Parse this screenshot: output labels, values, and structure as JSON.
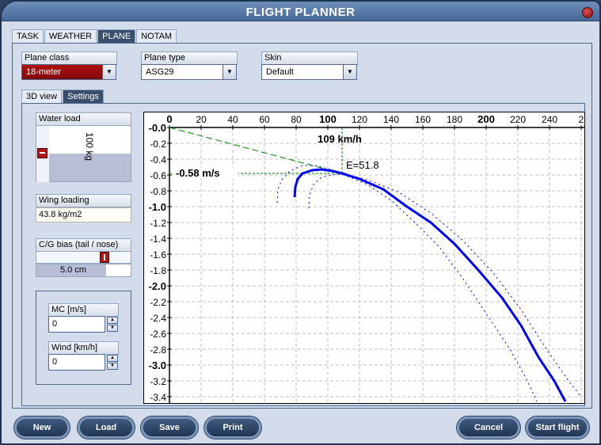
{
  "window": {
    "title": "FLIGHT PLANNER"
  },
  "tabs": [
    {
      "label": "TASK"
    },
    {
      "label": "WEATHER"
    },
    {
      "label": "PLANE",
      "active": true
    },
    {
      "label": "NOTAM"
    }
  ],
  "plane_class": {
    "label": "Plane class",
    "value": "18-meter"
  },
  "plane_type": {
    "label": "Plane type",
    "value": "ASG29"
  },
  "skin": {
    "label": "Skin",
    "value": "Default"
  },
  "subtabs": [
    {
      "label": "3D view"
    },
    {
      "label": "Settings",
      "active": true
    }
  ],
  "water_load": {
    "label": "Water load",
    "value": "100 kg"
  },
  "wing_loading": {
    "label": "Wing loading",
    "value": "43.8 kg/m2"
  },
  "cg_bias": {
    "label": "C/G bias (tail / nose)",
    "value": "5.0 cm"
  },
  "mc": {
    "label": "MC [m/s]",
    "value": "0"
  },
  "wind": {
    "label": "Wind [km/h]",
    "value": "0"
  },
  "buttons": {
    "new": "New",
    "load": "Load",
    "save": "Save",
    "print": "Print",
    "cancel": "Cancel",
    "start": "Start flight"
  },
  "colors": {
    "accent": "#3a4f6c",
    "polar": "#0000ff",
    "tangent": "#008000",
    "red": "#a00c0c"
  },
  "chart_data": {
    "type": "line",
    "xlim": [
      0,
      260
    ],
    "ylim": [
      -3.45,
      0
    ],
    "x_ticks": [
      0,
      20,
      40,
      60,
      80,
      100,
      120,
      140,
      160,
      180,
      200,
      220,
      240,
      260
    ],
    "x_tick_labels": [
      "0",
      "20",
      "40",
      "60",
      "80",
      "100",
      "120",
      "140",
      "160",
      "180",
      "200",
      "220",
      "240",
      "2"
    ],
    "y_ticks": [
      0,
      -0.2,
      -0.4,
      -0.6,
      -0.8,
      -1.0,
      -1.2,
      -1.4,
      -1.6,
      -1.8,
      -2.0,
      -2.2,
      -2.4,
      -2.6,
      -2.8,
      -3.0,
      -3.2,
      -3.4
    ],
    "y_tick_labels": [
      "-0.0",
      "-0.2",
      "-0.4",
      "-0.6",
      "-0.8",
      "-1.0",
      "-1.2",
      "-1.4",
      "-1.6",
      "-1.8",
      "-2.0",
      "-2.2",
      "-2.4",
      "-2.6",
      "-2.8",
      "-3.0",
      "-3.2",
      "-3.4"
    ],
    "grid": true,
    "series": [
      {
        "style": "solid",
        "points": [
          [
            79,
            -0.88
          ],
          [
            79.5,
            -0.75
          ],
          [
            81,
            -0.65
          ],
          [
            84,
            -0.58
          ],
          [
            90,
            -0.54
          ],
          [
            96,
            -0.53
          ],
          [
            103,
            -0.55
          ],
          [
            109,
            -0.58
          ],
          [
            120,
            -0.65
          ],
          [
            135,
            -0.78
          ],
          [
            150,
            -1.0
          ],
          [
            165,
            -1.2
          ],
          [
            180,
            -1.47
          ],
          [
            195,
            -1.8
          ],
          [
            210,
            -2.15
          ],
          [
            222,
            -2.5
          ],
          [
            233,
            -2.9
          ],
          [
            243,
            -3.2
          ],
          [
            250,
            -3.46
          ]
        ]
      },
      {
        "style": "dotted",
        "points": [
          [
            68,
            -0.95
          ],
          [
            68.5,
            -0.78
          ],
          [
            71,
            -0.66
          ],
          [
            76,
            -0.55
          ],
          [
            84,
            -0.48
          ],
          [
            92,
            -0.48
          ],
          [
            100,
            -0.52
          ],
          [
            109,
            -0.58
          ],
          [
            125,
            -0.66
          ],
          [
            145,
            -0.82
          ],
          [
            165,
            -1.08
          ],
          [
            185,
            -1.42
          ],
          [
            205,
            -1.85
          ],
          [
            222,
            -2.3
          ],
          [
            238,
            -2.8
          ],
          [
            252,
            -3.2
          ],
          [
            260,
            -3.4
          ]
        ]
      },
      {
        "style": "dotted",
        "points": [
          [
            88,
            -1.02
          ],
          [
            88.5,
            -0.85
          ],
          [
            91,
            -0.72
          ],
          [
            96,
            -0.63
          ],
          [
            102,
            -0.6
          ],
          [
            109,
            -0.59
          ],
          [
            125,
            -0.72
          ],
          [
            140,
            -0.92
          ],
          [
            155,
            -1.2
          ],
          [
            170,
            -1.5
          ],
          [
            185,
            -1.9
          ],
          [
            200,
            -2.35
          ],
          [
            215,
            -2.8
          ],
          [
            226,
            -3.2
          ],
          [
            232,
            -3.46
          ]
        ]
      }
    ],
    "tangent": {
      "from": [
        0,
        0
      ],
      "to": [
        109,
        -0.58
      ]
    },
    "annotations": {
      "speed": "109 km/h",
      "sink": "-0.58 m/s",
      "glide": "E=51.8"
    },
    "best_glide_point": [
      109,
      -0.58
    ]
  }
}
